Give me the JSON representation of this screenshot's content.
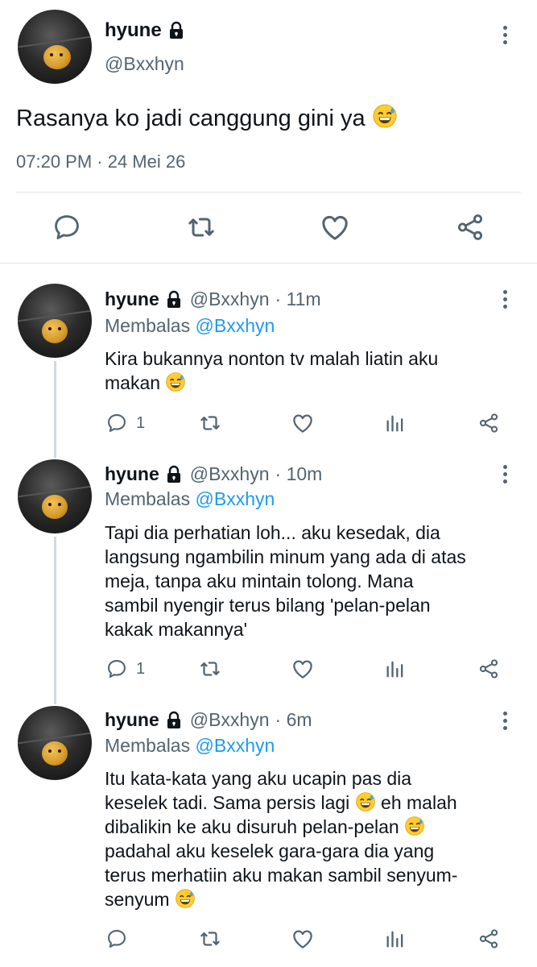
{
  "main_tweet": {
    "author_name": "hyune",
    "author_handle": "@Bxxhyn",
    "text": "Rasanya ko jadi canggung gini ya",
    "meta": "07:20 PM · 24 Mei 26",
    "actions": [
      "reply-icon",
      "retweet-icon",
      "like-icon",
      "share-icon"
    ]
  },
  "replies": [
    {
      "author_name": "hyune",
      "author_handle": "@Bxxhyn",
      "time": "· 11m",
      "replying_label": "Membalas",
      "replying_to": "@Bxxhyn",
      "text_lines": [
        "Kira bukannya nonton tv malah liatin aku",
        "makan"
      ],
      "reply_count": "1"
    },
    {
      "author_name": "hyune",
      "author_handle": "@Bxxhyn",
      "time": "· 10m",
      "replying_label": "Membalas",
      "replying_to": "@Bxxhyn",
      "text_lines": [
        "Tapi dia perhatian loh... aku kesedak, dia",
        "langsung ngambilin minum yang ada di atas",
        "meja, tanpa aku mintain tolong. Mana",
        "sambil nyengir terus bilang 'pelan-pelan",
        "kakak makannya'"
      ],
      "reply_count": "1"
    },
    {
      "author_name": "hyune",
      "author_handle": "@Bxxhyn",
      "time": "· 6m",
      "replying_label": "Membalas",
      "replying_to": "@Bxxhyn",
      "text_lines": [
        "Itu kata-kata yang aku ucapin pas dia",
        "keselek tadi. Sama persis lagi",
        "eh malah",
        "dibalikin ke aku disuruh pelan-pelan",
        "padahal aku keselek gara-gara dia yang",
        "terus merhatiin aku makan sambil senyum-",
        "senyum"
      ],
      "reply_count": ""
    }
  ],
  "colors": {
    "accent": "#1d9bf0",
    "muted": "#536471",
    "text": "#0f1419",
    "divider": "#e1e4e6"
  }
}
